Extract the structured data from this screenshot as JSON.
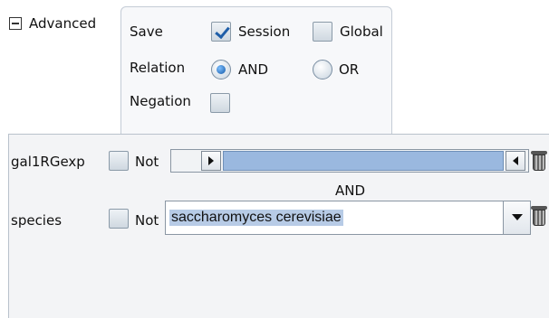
{
  "advanced": {
    "toggle_symbol": "⊟",
    "label": "Advanced"
  },
  "options": {
    "save_label": "Save",
    "session_label": "Session",
    "session_checked": true,
    "global_label": "Global",
    "global_checked": false,
    "relation_label": "Relation",
    "and_label": "AND",
    "or_label": "OR",
    "relation_selected": "AND",
    "negation_label": "Negation",
    "negation_checked": false
  },
  "filters": {
    "row1": {
      "name": "gal1RGexp",
      "not_label": "Not",
      "not_checked": false
    },
    "operator": "AND",
    "row2": {
      "name": "species",
      "not_label": "Not",
      "not_checked": false,
      "value": "saccharomyces cerevisiae"
    }
  },
  "colors": {
    "range_fill": "#9ab8df",
    "text_highlight": "#b7cbe6",
    "panel_border": "#c4ccd6"
  }
}
